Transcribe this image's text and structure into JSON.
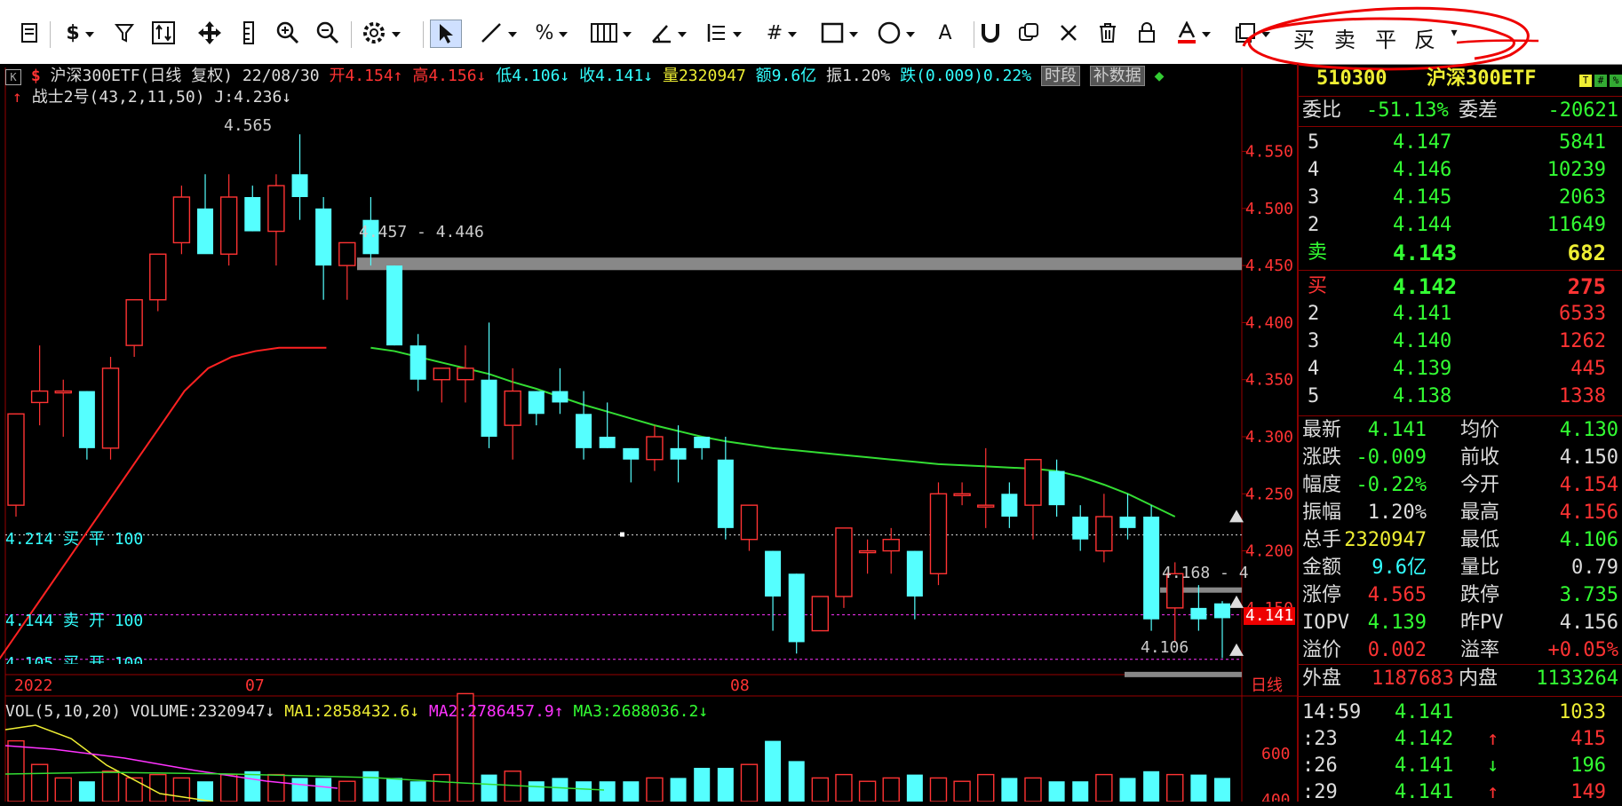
{
  "toolbar": {
    "tools": [
      "K-line",
      "document-icon",
      "dollar-icon",
      "filter-icon",
      "exchange-icon",
      "move-icon",
      "ruler-icon",
      "zoom-in-icon",
      "zoom-out-icon",
      "gear-icon",
      "pointer-icon",
      "line-icon",
      "percent-icon",
      "grid-icon",
      "angle-icon",
      "bars-icon",
      "hash-icon",
      "rect-icon",
      "circle-icon",
      "text-A-icon",
      "magnet-icon",
      "copy-icon",
      "close-icon",
      "trash-icon",
      "lock-icon",
      "font-color-icon",
      "layers-icon"
    ],
    "order_buttons": {
      "buy": "买",
      "sell": "卖",
      "close": "平",
      "reverse": "反"
    }
  },
  "chart_info": {
    "title": "沪深300ETF(日线 复权)",
    "date": "22/08/30",
    "open_label": "开",
    "open": "4.154",
    "high_label": "高",
    "high": "4.156",
    "low_label": "低",
    "low": "4.106",
    "close_label": "收",
    "close": "4.141",
    "volume_label": "量",
    "volume": "2320947",
    "amount_label": "额",
    "amount": "9.6亿",
    "amplitude_label": "振",
    "amplitude": "1.20%",
    "change_label": "跌",
    "change": "(0.009)0.22%",
    "btn_timeshare": "时段",
    "btn_supplement": "补数据",
    "indicator": "战士2号(43,2,11,50)",
    "indicator_j": "J:4.236"
  },
  "chart_data": {
    "type": "candlestick",
    "ylim": [
      4.09,
      4.58
    ],
    "y_ticks": [
      "4.550",
      "4.500",
      "4.450",
      "4.400",
      "4.350",
      "4.300",
      "4.250",
      "4.200",
      "4.150"
    ],
    "x_labels": [
      "2022",
      "07",
      "08"
    ],
    "period_label": "日线",
    "candles": [
      {
        "o": 4.24,
        "h": 4.31,
        "l": 4.23,
        "c": 4.32
      },
      {
        "o": 4.33,
        "h": 4.38,
        "l": 4.31,
        "c": 4.34
      },
      {
        "o": 4.34,
        "h": 4.35,
        "l": 4.3,
        "c": 4.34
      },
      {
        "o": 4.34,
        "h": 4.34,
        "l": 4.28,
        "c": 4.29
      },
      {
        "o": 4.29,
        "h": 4.37,
        "l": 4.28,
        "c": 4.36
      },
      {
        "o": 4.38,
        "h": 4.42,
        "l": 4.37,
        "c": 4.42
      },
      {
        "o": 4.42,
        "h": 4.46,
        "l": 4.41,
        "c": 4.46
      },
      {
        "o": 4.47,
        "h": 4.52,
        "l": 4.46,
        "c": 4.51
      },
      {
        "o": 4.5,
        "h": 4.53,
        "l": 4.47,
        "c": 4.46
      },
      {
        "o": 4.46,
        "h": 4.53,
        "l": 4.45,
        "c": 4.51
      },
      {
        "o": 4.51,
        "h": 4.52,
        "l": 4.48,
        "c": 4.48
      },
      {
        "o": 4.48,
        "h": 4.53,
        "l": 4.45,
        "c": 4.52
      },
      {
        "o": 4.53,
        "h": 4.565,
        "l": 4.49,
        "c": 4.51
      },
      {
        "o": 4.5,
        "h": 4.51,
        "l": 4.42,
        "c": 4.45
      },
      {
        "o": 4.45,
        "h": 4.47,
        "l": 4.42,
        "c": 4.47
      },
      {
        "o": 4.49,
        "h": 4.51,
        "l": 4.45,
        "c": 4.46
      },
      {
        "o": 4.45,
        "h": 4.45,
        "l": 4.38,
        "c": 4.38
      },
      {
        "o": 4.38,
        "h": 4.39,
        "l": 4.34,
        "c": 4.35
      },
      {
        "o": 4.35,
        "h": 4.36,
        "l": 4.33,
        "c": 4.36
      },
      {
        "o": 4.35,
        "h": 4.38,
        "l": 4.33,
        "c": 4.36
      },
      {
        "o": 4.35,
        "h": 4.4,
        "l": 4.29,
        "c": 4.3
      },
      {
        "o": 4.31,
        "h": 4.36,
        "l": 4.28,
        "c": 4.34
      },
      {
        "o": 4.34,
        "h": 4.34,
        "l": 4.31,
        "c": 4.32
      },
      {
        "o": 4.34,
        "h": 4.36,
        "l": 4.32,
        "c": 4.33
      },
      {
        "o": 4.32,
        "h": 4.34,
        "l": 4.28,
        "c": 4.29
      },
      {
        "o": 4.3,
        "h": 4.33,
        "l": 4.29,
        "c": 4.29
      },
      {
        "o": 4.29,
        "h": 4.29,
        "l": 4.26,
        "c": 4.28
      },
      {
        "o": 4.28,
        "h": 4.31,
        "l": 4.27,
        "c": 4.3
      },
      {
        "o": 4.29,
        "h": 4.31,
        "l": 4.26,
        "c": 4.28
      },
      {
        "o": 4.3,
        "h": 4.3,
        "l": 4.28,
        "c": 4.29
      },
      {
        "o": 4.28,
        "h": 4.3,
        "l": 4.21,
        "c": 4.22
      },
      {
        "o": 4.21,
        "h": 4.24,
        "l": 4.2,
        "c": 4.24
      },
      {
        "o": 4.2,
        "h": 4.2,
        "l": 4.13,
        "c": 4.16
      },
      {
        "o": 4.18,
        "h": 4.18,
        "l": 4.11,
        "c": 4.12
      },
      {
        "o": 4.13,
        "h": 4.16,
        "l": 4.13,
        "c": 4.16
      },
      {
        "o": 4.16,
        "h": 4.22,
        "l": 4.15,
        "c": 4.22
      },
      {
        "o": 4.2,
        "h": 4.21,
        "l": 4.18,
        "c": 4.2
      },
      {
        "o": 4.2,
        "h": 4.22,
        "l": 4.18,
        "c": 4.21
      },
      {
        "o": 4.2,
        "h": 4.2,
        "l": 4.14,
        "c": 4.16
      },
      {
        "o": 4.18,
        "h": 4.26,
        "l": 4.17,
        "c": 4.25
      },
      {
        "o": 4.25,
        "h": 4.26,
        "l": 4.24,
        "c": 4.25
      },
      {
        "o": 4.24,
        "h": 4.29,
        "l": 4.22,
        "c": 4.24
      },
      {
        "o": 4.25,
        "h": 4.26,
        "l": 4.22,
        "c": 4.23
      },
      {
        "o": 4.24,
        "h": 4.28,
        "l": 4.21,
        "c": 4.28
      },
      {
        "o": 4.27,
        "h": 4.28,
        "l": 4.23,
        "c": 4.24
      },
      {
        "o": 4.23,
        "h": 4.24,
        "l": 4.2,
        "c": 4.21
      },
      {
        "o": 4.2,
        "h": 4.25,
        "l": 4.19,
        "c": 4.23
      },
      {
        "o": 4.23,
        "h": 4.25,
        "l": 4.21,
        "c": 4.22
      },
      {
        "o": 4.23,
        "h": 4.24,
        "l": 4.13,
        "c": 4.14
      },
      {
        "o": 4.15,
        "h": 4.19,
        "l": 4.12,
        "c": 4.18
      },
      {
        "o": 4.15,
        "h": 4.17,
        "l": 4.13,
        "c": 4.14
      },
      {
        "o": 4.154,
        "h": 4.156,
        "l": 4.106,
        "c": 4.141
      }
    ],
    "ma_red": [
      4.08,
      4.1,
      4.13,
      4.16,
      4.19,
      4.22,
      4.25,
      4.28,
      4.31,
      4.34,
      4.36,
      4.37,
      4.375,
      4.378,
      4.378,
      4.378
    ],
    "ma_green": [
      4.378,
      4.375,
      4.37,
      4.365,
      4.36,
      4.355,
      4.348,
      4.342,
      4.335,
      4.328,
      4.322,
      4.316,
      4.31,
      4.305,
      4.3,
      4.296,
      4.293,
      4.29,
      4.288,
      4.286,
      4.284,
      4.282,
      4.28,
      4.278,
      4.276,
      4.275,
      4.274,
      4.273,
      4.272,
      4.27,
      4.265,
      4.258,
      4.25,
      4.24,
      4.23
    ],
    "annotations": {
      "high_label": "4.565",
      "low_label": "4.106",
      "zone_label": "4.457 - 4.446",
      "zone2_label": "4.168 - 4",
      "trade1": "4.214 买 平 100",
      "trade2": "4.144 卖 开 100",
      "trade3": "4.105 买 开 100",
      "price_tag": "4.141"
    },
    "volume": {
      "label": "VOL(5,10,20)",
      "volume": "VOLUME:2320947",
      "ma1": "MA1:2858432.6",
      "ma2": "MA2:2786457.9",
      "ma3": "MA3:2688036.2",
      "y_ticks": [
        "600",
        "400"
      ]
    }
  },
  "panel": {
    "code": "510300",
    "name": "沪深300ETF",
    "weibi_label": "委比",
    "weibi": "-51.13%",
    "weicha_label": "委差",
    "weicha": "-20621",
    "asks": [
      {
        "level": "5",
        "price": "4.147",
        "vol": "5841"
      },
      {
        "level": "4",
        "price": "4.146",
        "vol": "10239"
      },
      {
        "level": "3",
        "price": "4.145",
        "vol": "2063"
      },
      {
        "level": "2",
        "price": "4.144",
        "vol": "11649"
      },
      {
        "level": "卖",
        "price": "4.143",
        "vol": "682"
      }
    ],
    "bids": [
      {
        "level": "买",
        "price": "4.142",
        "vol": "275"
      },
      {
        "level": "2",
        "price": "4.141",
        "vol": "6533"
      },
      {
        "level": "3",
        "price": "4.140",
        "vol": "1262"
      },
      {
        "level": "4",
        "price": "4.139",
        "vol": "445"
      },
      {
        "level": "5",
        "price": "4.138",
        "vol": "1338"
      }
    ],
    "stats": [
      {
        "l1": "最新",
        "v1": "4.141",
        "c1": "#3f3",
        "l2": "均价",
        "v2": "4.130",
        "c2": "#3f3"
      },
      {
        "l1": "涨跌",
        "v1": "-0.009",
        "c1": "#3f3",
        "l2": "前收",
        "v2": "4.150",
        "c2": "#ddd"
      },
      {
        "l1": "幅度",
        "v1": "-0.22%",
        "c1": "#3f3",
        "l2": "今开",
        "v2": "4.154",
        "c2": "#f33"
      },
      {
        "l1": "振幅",
        "v1": "1.20%",
        "c1": "#ddd",
        "l2": "最高",
        "v2": "4.156",
        "c2": "#f33"
      },
      {
        "l1": "总手",
        "v1": "2320947",
        "c1": "#ee3",
        "l2": "最低",
        "v2": "4.106",
        "c2": "#3f3"
      },
      {
        "l1": "金额",
        "v1": "9.6亿",
        "c1": "#3ff",
        "l2": "量比",
        "v2": "0.79",
        "c2": "#ddd"
      },
      {
        "l1": "涨停",
        "v1": "4.565",
        "c1": "#f33",
        "l2": "跌停",
        "v2": "3.735",
        "c2": "#3f3"
      },
      {
        "l1": "IOPV",
        "v1": "4.139",
        "c1": "#3f3",
        "l2": "昨PV",
        "v2": "4.156",
        "c2": "#ddd"
      },
      {
        "l1": "溢价",
        "v1": "0.002",
        "c1": "#f33",
        "l2": "溢率",
        "v2": "+0.05%",
        "c2": "#f33"
      }
    ],
    "outer_label": "外盘",
    "outer": "1187683",
    "inner_label": "内盘",
    "inner": "1133264",
    "ticks": [
      {
        "time": "14:59",
        "price": "4.141",
        "arrow": "",
        "vol": "1033",
        "color": "#ee3"
      },
      {
        "time": ":23",
        "price": "4.142",
        "arrow": "↑",
        "vol": "415",
        "color": "#f33"
      },
      {
        "time": ":26",
        "price": "4.141",
        "arrow": "↓",
        "vol": "196",
        "color": "#3f3"
      },
      {
        "time": ":29",
        "price": "4.141",
        "arrow": "↑",
        "vol": "149",
        "color": "#f33"
      }
    ]
  }
}
